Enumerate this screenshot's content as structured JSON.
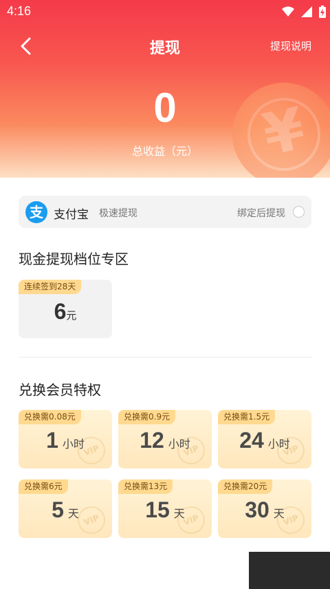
{
  "status_bar": {
    "time": "4:16"
  },
  "header": {
    "title": "提现",
    "help_link": "提现说明",
    "amount": "0",
    "amount_label": "总收益（元）"
  },
  "payment": {
    "logo_char": "支",
    "name": "支付宝",
    "subtitle": "极速提现",
    "bind_text": "绑定后提现"
  },
  "cash_section": {
    "title": "现金提现档位专区",
    "tiers": [
      {
        "tag": "连续签到28天",
        "value": "6",
        "unit": "元"
      }
    ]
  },
  "vip_section": {
    "title": "兑换会员特权",
    "watermark": "VIP",
    "items": [
      {
        "tag": "兑换需0.08元",
        "value": "1",
        "unit": "小时"
      },
      {
        "tag": "兑换需0.9元",
        "value": "12",
        "unit": "小时"
      },
      {
        "tag": "兑换需1.5元",
        "value": "24",
        "unit": "小时"
      },
      {
        "tag": "兑换需6元",
        "value": "5",
        "unit": "天"
      },
      {
        "tag": "兑换需13元",
        "value": "15",
        "unit": "天"
      },
      {
        "tag": "兑换需20元",
        "value": "30",
        "unit": "天"
      }
    ]
  },
  "colors": {
    "header_top": "#f53a4a",
    "alipay_blue": "#1a9cf0",
    "tag_bg": "#ffd98f",
    "vip_card_bg": "#ffeec8"
  },
  "icons": [
    "wifi-icon",
    "signal-icon",
    "battery-charging-icon",
    "back-arrow-icon",
    "yuan-coin-decoration",
    "alipay-logo-icon",
    "vip-badge-icon"
  ]
}
